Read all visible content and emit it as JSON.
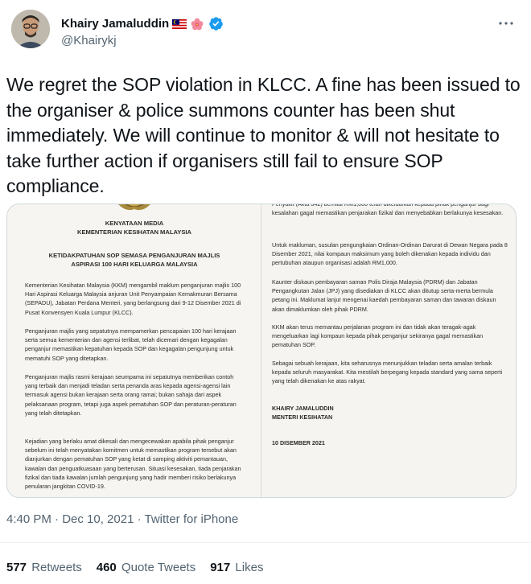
{
  "author": {
    "name": "Khairy Jamaluddin",
    "handle": "@Khairykj",
    "verified": true
  },
  "tweet": {
    "text": "We regret the SOP violation in KLCC. A fine has been issued to the organiser & police summons counter has been shut immediately. We will continue to monitor & will not hesitate to take further action if organisers still fail to ensure SOP compliance.",
    "timestamp": "4:40 PM · Dec 10, 2021 · Twitter for iPhone"
  },
  "media": {
    "left_page": {
      "header1": "KENYATAAN MEDIA",
      "header2": "KEMENTERIAN KESIHATAN MALAYSIA",
      "subject": "KETIDAKPATUHAN SOP SEMASA PENGANJURAN MAJLIS ASPIRASI 100 HARI KELUARGA MALAYSIA",
      "p1": "Kementerian Kesihatan Malaysia (KKM) mengambil maklum penganjuran majlis 100 Hari Aspirasi Keluarga Malaysia anjuran Unit Penyampaian Kemakmuran Bersama (SEPADU), Jabatan Perdana Menteri, yang berlangsung dari 9-12 Disember 2021 di Pusat Konvensyen Kuala Lumpur (KLCC).",
      "p2": "Penganjuran majlis yang sepatutnya mempamerkan pencapaian 100 hari kerajaan serta semua kementerian dan agensi terlibat, telah dicemari dengan kegagalan penganjur memastikan kepatuhan kepada SOP dan kegagalan pengunjung untuk mematuhi SOP yang ditetapkan.",
      "p3": "Penganjuran majlis rasmi kerajaan seumpama ini sepatutnya memberikan contoh yang terbaik dan menjadi teladan serta penanda aras kepada agensi-agensi lain termasuk agensi bukan kerajaan serta orang ramai; bukan sahaja dari aspek pelaksanaan program, tetapi juga aspek pematuhan SOP dan peraturan-peraturan yang telah ditetapkan.",
      "p4": "Kejadian yang berlaku amat dikesali dan mengecewakan apabila pihak penganjur sebelum ini telah menyatakan komitmen untuk memastikan program tersebut akan dianjurkan dengan pematuhan SOP yang ketat di samping aktiviti pemantauan, kawalan dan penguatkuasaan yang berterusan. Situasi kesesakan, tiada penjarakan fizikal dan tiada kawalan jumlah pengunjung yang hadir memberi risiko berlakunya penularan jangkitan COVID-19."
    },
    "right_page": {
      "p0": "Penyakit (Akta 342) bernilai RM1,000 telah dikeluarkan kepada pihak penganjur bagi kesalahan gagal memastikan penjarakan fizikal dan menyebabkan berlakunya kesesakan.",
      "p1": "Untuk makluman, susulan pengungkaian Ordinan-Ordinan Darurat di Dewan Negara pada 8 Disember 2021, nilai kompaun maksimum yang boleh dikenakan kepada individu dan pertubuhan ataupun organisasi adalah RM1,000.",
      "p2": "Kaunter diskaun pembayaran saman Polis Diraja Malaysia (PDRM) dan Jabatan Pengangkutan Jalan (JPJ) yang disediakan di KLCC akan ditutup serta-merta bermula petang ini. Maklumat lanjut mengenai kaedah pembayaran saman dan tawaran diskaun akan dimaklumkan oleh pihak PDRM.",
      "p3": "KKM akan terus memantau perjalanan program ini dan tidak akan teragak-agak mengeluarkan lagi kompaun kepada pihak penganjur sekiranya gagal memastikan pematuhan SOP.",
      "p4": "Sebagai sebuah kerajaan, kita seharusnya menunjukkan teladan serta amalan terbaik kepada seluruh masyarakat. Kita mestilah berpegang kepada standard yang sama seperti yang telah dikenakan ke atas rakyat.",
      "signature_name": "KHAIRY JAMALUDDIN",
      "signature_title": "MENTERI KESIHATAN",
      "date": "10 DISEMBER 2021"
    }
  },
  "stats": {
    "retweets_count": "577",
    "retweets_label": "Retweets",
    "quotes_count": "460",
    "quotes_label": "Quote Tweets",
    "likes_count": "917",
    "likes_label": "Likes"
  },
  "colors": {
    "text_primary": "#0f1419",
    "text_secondary": "#536471",
    "verified_blue": "#1d9bf0",
    "border": "#cfd9de"
  }
}
